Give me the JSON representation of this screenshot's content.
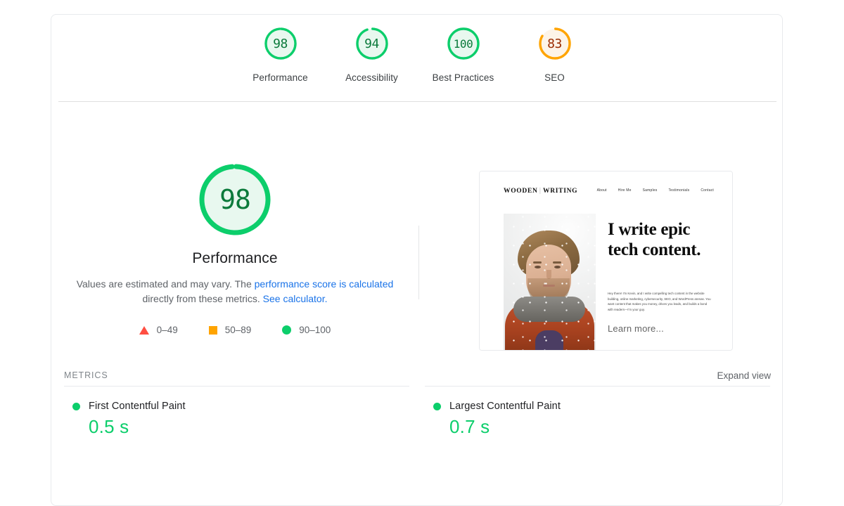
{
  "theme": {
    "green": "#0cce6b",
    "green_text": "#0b7a3b",
    "green_fill": "#e8f8ef",
    "orange": "#ffa400",
    "orange_fill": "#fef6ec",
    "orange_text": "#9a2b00",
    "red": "#ff4e42",
    "link_blue": "#1a73e8"
  },
  "categories": [
    {
      "score": "98",
      "label": "Performance",
      "pct": 98,
      "status": "pass"
    },
    {
      "score": "94",
      "label": "Accessibility",
      "pct": 94,
      "status": "pass"
    },
    {
      "score": "100",
      "label": "Best Practices",
      "pct": 100,
      "status": "pass"
    },
    {
      "score": "83",
      "label": "SEO",
      "pct": 83,
      "status": "average"
    }
  ],
  "performance": {
    "score": "98",
    "pct": 98,
    "label": "Performance",
    "description_lead": "Values are estimated and may vary. The ",
    "description_link1": "performance score is calculated",
    "description_mid": " directly from these metrics. ",
    "description_link2": "See calculator.",
    "legend": [
      {
        "shape": "triangle",
        "range": "0–49",
        "color": "#ff4e42"
      },
      {
        "shape": "square",
        "range": "50–89",
        "color": "#ffa400"
      },
      {
        "shape": "circle",
        "range": "90–100",
        "color": "#0cce6b"
      }
    ]
  },
  "thumbnail": {
    "brand_left": "WOODEN",
    "brand_divider": "∣",
    "brand_right": "WRITING",
    "nav": [
      "About",
      "Hire Me",
      "Samples",
      "Testimonials",
      "Contact"
    ],
    "headline": "I write epic tech content.",
    "body": "Hey there! I'm Kevin, and I write compelling tech content in the website building, online marketing, cybersecurity, SEO, and WordPress arenas. You want content that makes you money, drives you leads, and builds a bond with readers—I'm your guy.",
    "cta": "Learn more..."
  },
  "metrics": {
    "section_title": "METRICS",
    "expand_label": "Expand view",
    "left": [
      {
        "name": "First Contentful Paint",
        "value": "0.5 s",
        "status": "pass"
      }
    ],
    "right": [
      {
        "name": "Largest Contentful Paint",
        "value": "0.7 s",
        "status": "pass"
      }
    ]
  }
}
